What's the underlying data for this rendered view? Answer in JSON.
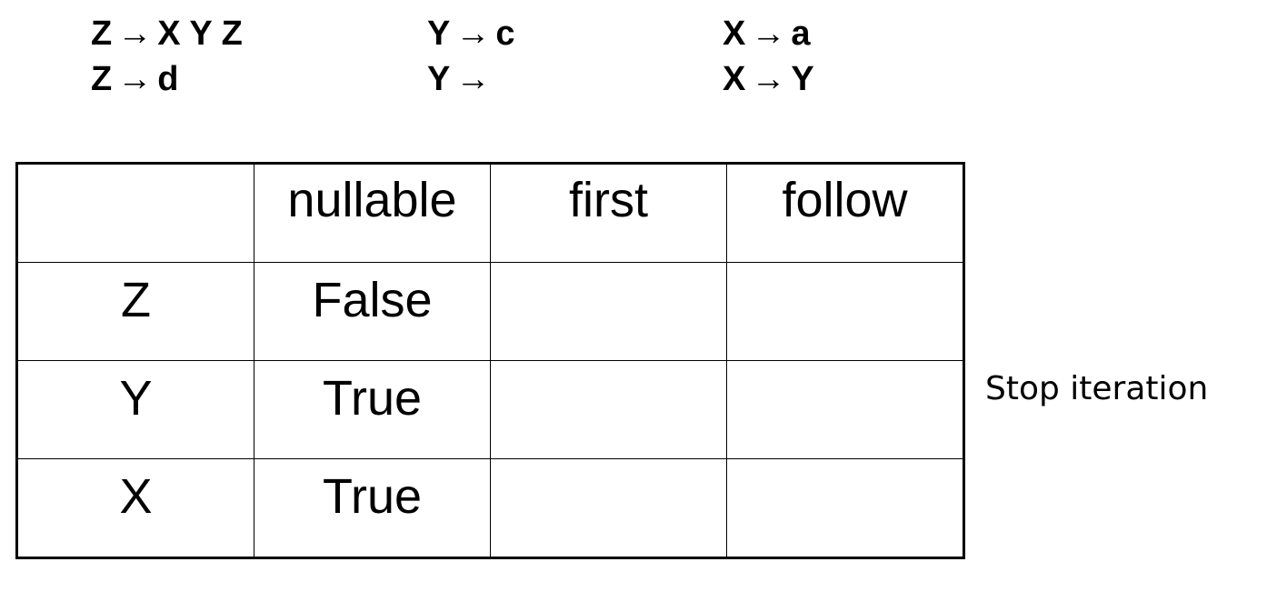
{
  "grammar": {
    "productions": [
      {
        "lhs": "Z",
        "arrow": "→",
        "rhs": "X Y Z"
      },
      {
        "lhs": "Z",
        "arrow": "→",
        "rhs": "d"
      },
      {
        "lhs": "Y",
        "arrow": "→",
        "rhs": "c"
      },
      {
        "lhs": "Y",
        "arrow": "→",
        "rhs": ""
      },
      {
        "lhs": "X",
        "arrow": "→",
        "rhs": "a"
      },
      {
        "lhs": "X",
        "arrow": "→",
        "rhs": "Y"
      }
    ]
  },
  "table": {
    "headers": [
      "",
      "nullable",
      "first",
      "follow"
    ],
    "rows": [
      {
        "symbol": "Z",
        "nullable": "False",
        "first": "",
        "follow": ""
      },
      {
        "symbol": "Y",
        "nullable": "True",
        "first": "",
        "follow": ""
      },
      {
        "symbol": "X",
        "nullable": "True",
        "first": "",
        "follow": ""
      }
    ]
  },
  "note": "Stop iteration"
}
